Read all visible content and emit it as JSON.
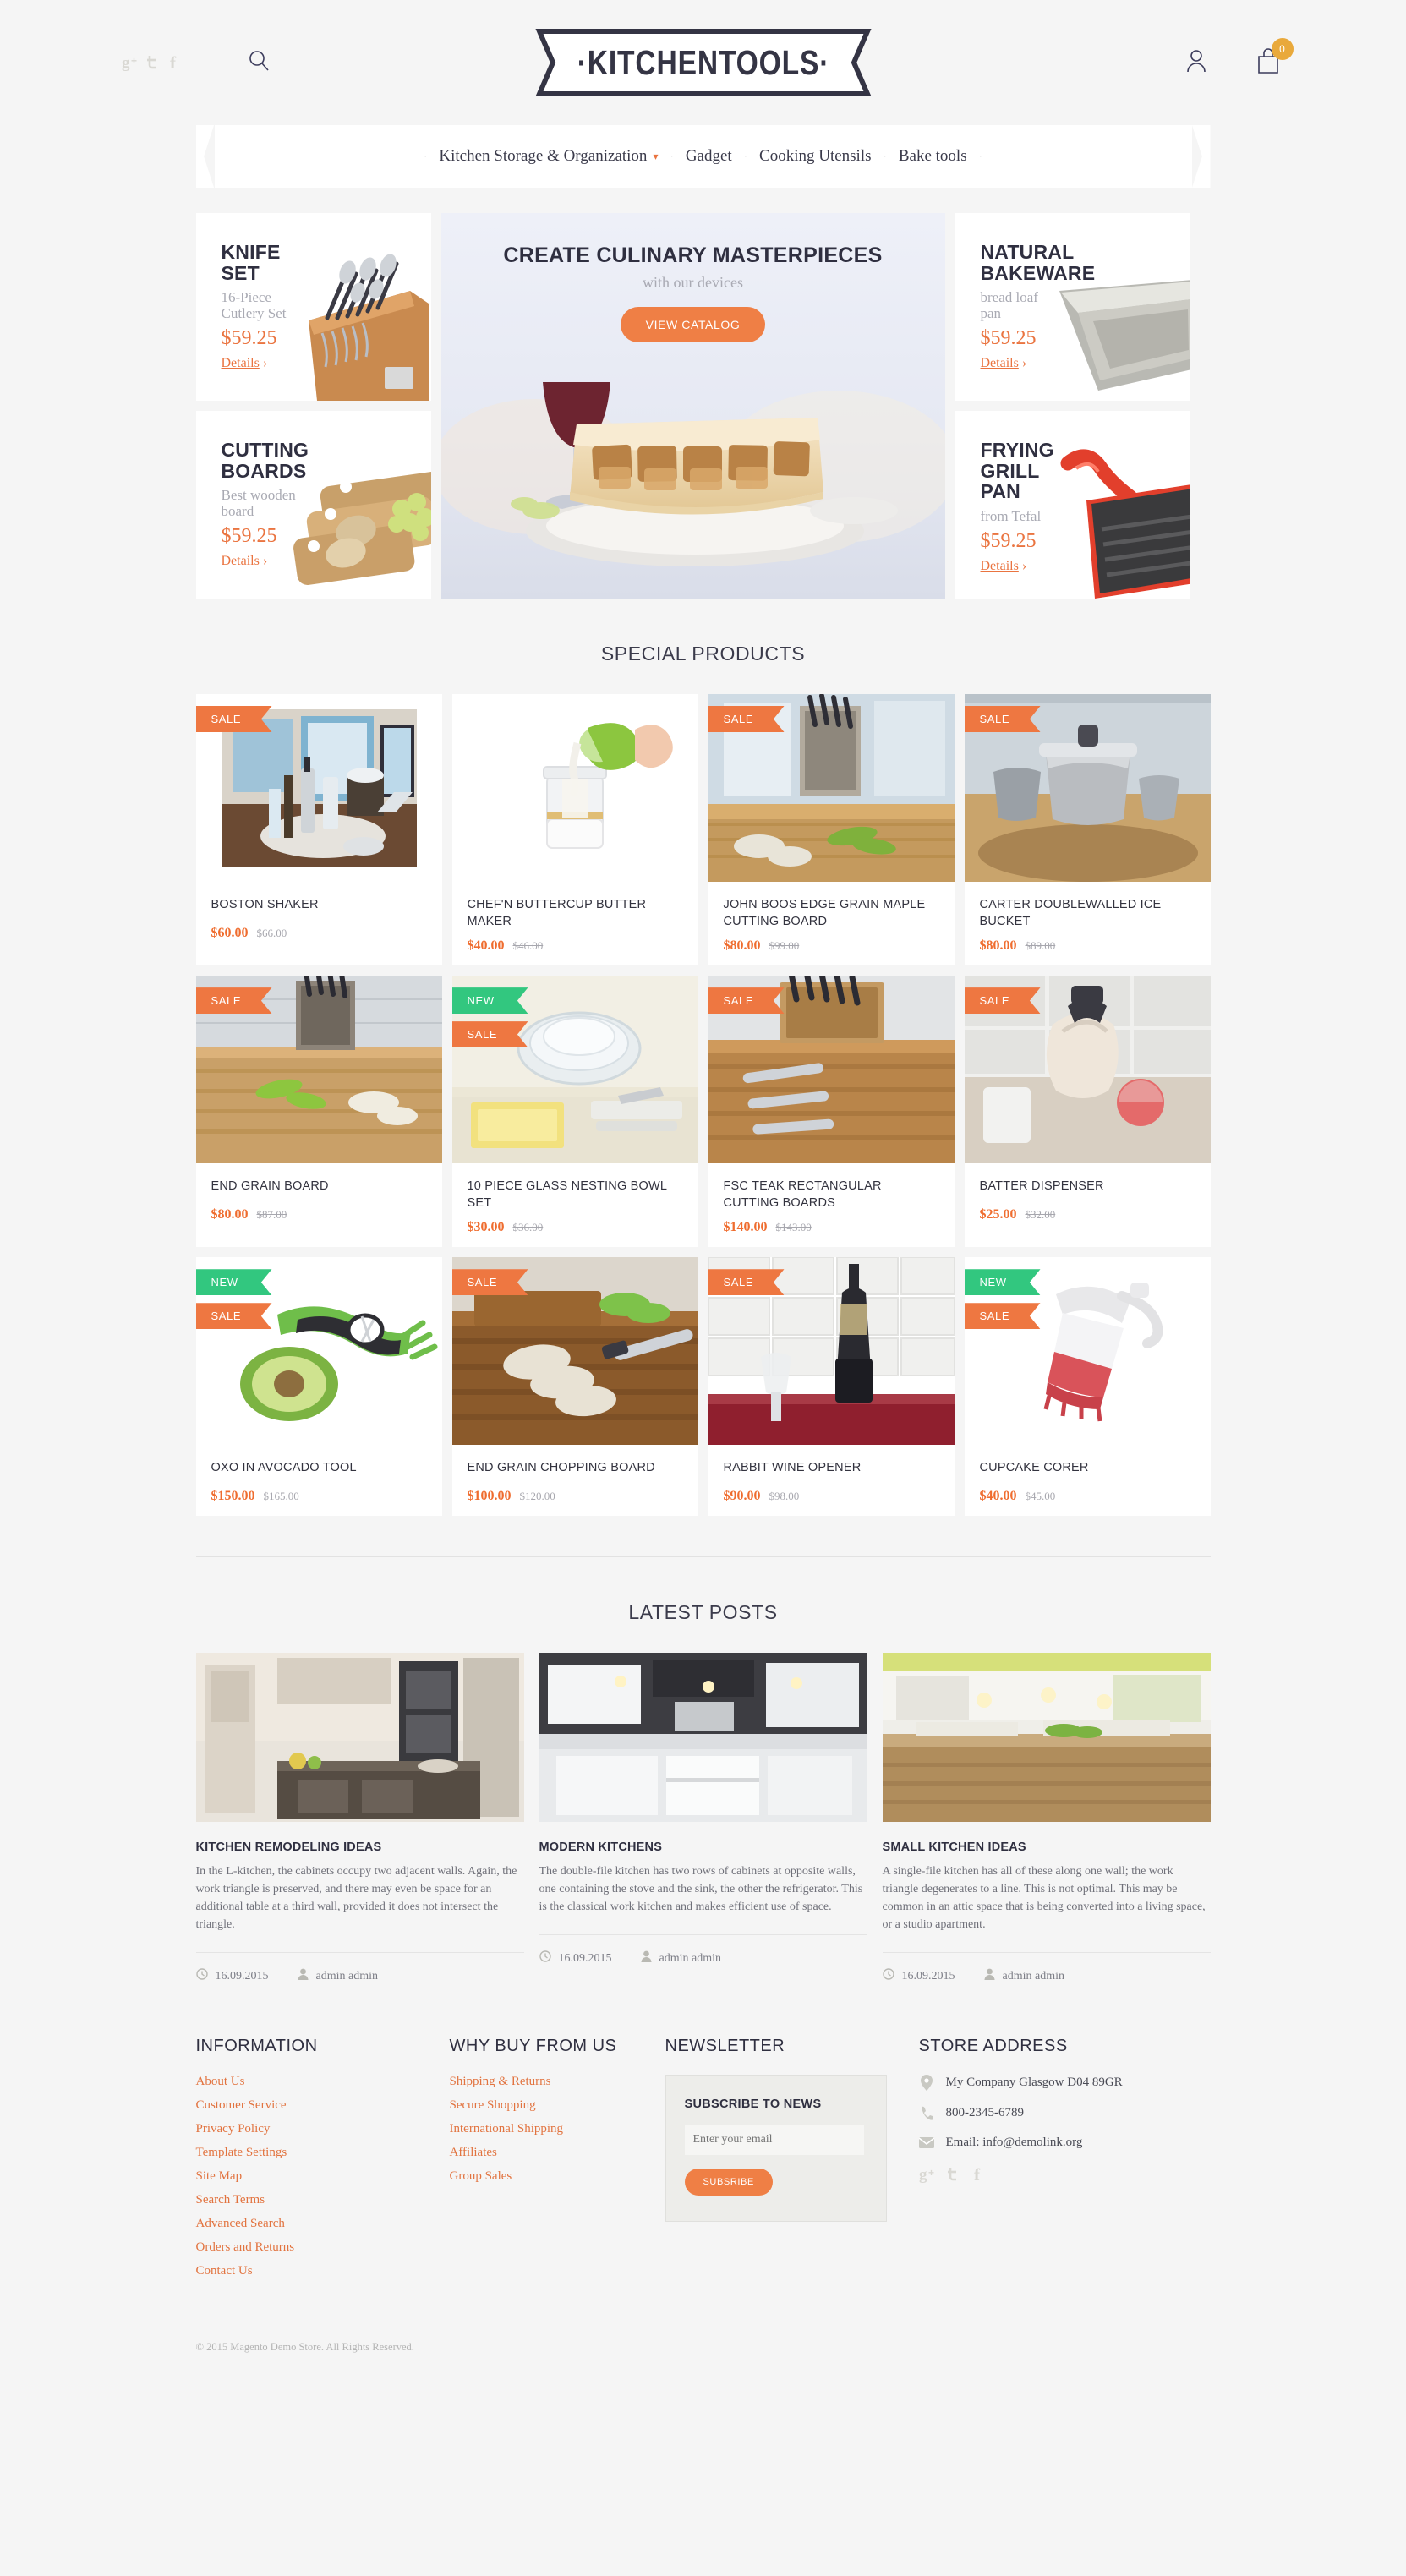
{
  "header": {
    "logo_text": "·KITCHENTOOLS·",
    "social": [
      "google-plus-icon",
      "twitter-icon",
      "facebook-icon"
    ],
    "search_icon": "search-icon",
    "account_icon": "user-icon",
    "cart_icon": "cart-icon",
    "cart_count": "0"
  },
  "nav": {
    "items": [
      {
        "label": "Kitchen Storage & Organization",
        "has_caret": true
      },
      {
        "label": "Gadget",
        "has_caret": false
      },
      {
        "label": "Cooking Utensils",
        "has_caret": false
      },
      {
        "label": "Bake tools",
        "has_caret": false
      }
    ]
  },
  "promos": {
    "knife": {
      "title": "KNIFE\nSET",
      "sub": "16-Piece\nCutlery Set",
      "price": "$59.25",
      "details": "Details"
    },
    "cutting": {
      "title": "CUTTING\nBOARDS",
      "sub": "Best wooden\nboard",
      "price": "$59.25",
      "details": "Details"
    },
    "bakeware": {
      "title": "NATURAL\nBAKEWARE",
      "sub": "bread loaf\npan",
      "price": "$59.25",
      "details": "Details"
    },
    "frying": {
      "title": "FRYING\nGRILL\nPAN",
      "sub": "from Tefal",
      "price": "$59.25",
      "details": "Details"
    }
  },
  "hero": {
    "headline": "CREATE CULINARY MASTERPIECES",
    "subline": "with our devices",
    "cta": "VIEW CATALOG"
  },
  "special_products": {
    "title": "SPECIAL PRODUCTS",
    "items": [
      {
        "name": "BOSTON SHAKER",
        "price": "$60.00",
        "old_price": "$66.00",
        "badges": [
          "SALE"
        ]
      },
      {
        "name": "CHEF'N BUTTERCUP BUTTER MAKER",
        "price": "$40.00",
        "old_price": "$46.00",
        "badges": []
      },
      {
        "name": "JOHN BOOS EDGE GRAIN MAPLE CUTTING BOARD",
        "price": "$80.00",
        "old_price": "$99.00",
        "badges": [
          "SALE"
        ]
      },
      {
        "name": "CARTER DOUBLEWALLED ICE BUCKET",
        "price": "$80.00",
        "old_price": "$89.00",
        "badges": [
          "SALE"
        ]
      },
      {
        "name": "END GRAIN BOARD",
        "price": "$80.00",
        "old_price": "$87.00",
        "badges": [
          "SALE"
        ]
      },
      {
        "name": "10 PIECE GLASS NESTING BOWL SET",
        "price": "$30.00",
        "old_price": "$36.00",
        "badges": [
          "NEW",
          "SALE"
        ]
      },
      {
        "name": "FSC TEAK RECTANGULAR CUTTING BOARDS",
        "price": "$140.00",
        "old_price": "$143.00",
        "badges": [
          "SALE"
        ]
      },
      {
        "name": "BATTER DISPENSER",
        "price": "$25.00",
        "old_price": "$32.00",
        "badges": [
          "SALE"
        ]
      },
      {
        "name": "OXO IN AVOCADO TOOL",
        "price": "$150.00",
        "old_price": "$165.00",
        "badges": [
          "NEW",
          "SALE"
        ]
      },
      {
        "name": "END GRAIN CHOPPING BOARD",
        "price": "$100.00",
        "old_price": "$120.00",
        "badges": [
          "SALE"
        ]
      },
      {
        "name": "RABBIT WINE OPENER",
        "price": "$90.00",
        "old_price": "$98.00",
        "badges": [
          "SALE"
        ]
      },
      {
        "name": "CUPCAKE CORER",
        "price": "$40.00",
        "old_price": "$45.00",
        "badges": [
          "NEW",
          "SALE"
        ]
      }
    ]
  },
  "latest_posts": {
    "title": "LATEST POSTS",
    "items": [
      {
        "title": "KITCHEN REMODELING IDEAS",
        "body": "In the L-kitchen, the cabinets occupy two adjacent walls. Again, the work triangle is preserved, and there may even be space for an additional table at a third wall, provided it does not intersect the triangle.",
        "date": "16.09.2015",
        "author": "admin admin"
      },
      {
        "title": "MODERN KITCHENS",
        "body": "The double-file kitchen has two rows of cabinets at opposite walls, one containing the stove and the sink, the other the refrigerator. This is the classical work kitchen and makes efficient use of space.",
        "date": "16.09.2015",
        "author": "admin admin"
      },
      {
        "title": "SMALL KITCHEN IDEAS",
        "body": "A single-file kitchen has all of these along one wall; the work triangle degenerates to a line. This is not optimal. This may be common in an attic space that is being converted into a living space, or a studio apartment.",
        "date": "16.09.2015",
        "author": "admin admin"
      }
    ]
  },
  "footer": {
    "information": {
      "head": "INFORMATION",
      "links": [
        "About Us",
        "Customer Service",
        "Privacy Policy",
        "Template Settings",
        "Site Map",
        "Search Terms",
        "Advanced Search",
        "Orders and Returns",
        "Contact Us"
      ]
    },
    "why_buy": {
      "head": "WHY BUY FROM US",
      "links": [
        "Shipping & Returns",
        "Secure Shopping",
        "International Shipping",
        "Affiliates",
        "Group Sales"
      ]
    },
    "newsletter": {
      "head": "NEWSLETTER",
      "box_head": "SUBSCRIBE TO NEWS",
      "placeholder": "Enter your email",
      "input_value": "",
      "button": "SUBSRIBE"
    },
    "store": {
      "head": "STORE ADDRESS",
      "address": "My Company Glasgow D04 89GR",
      "phone": "800-2345-6789",
      "email": "Email: info@demolink.org",
      "social": [
        "google-plus-icon",
        "twitter-icon",
        "facebook-icon"
      ]
    },
    "copyright": "© 2015 Magento Demo Store. All Rights Reserved."
  },
  "colors": {
    "accent": "#ef7f45",
    "price": "#ef6c2e",
    "new": "#32c77f",
    "dark": "#2f2f40"
  }
}
